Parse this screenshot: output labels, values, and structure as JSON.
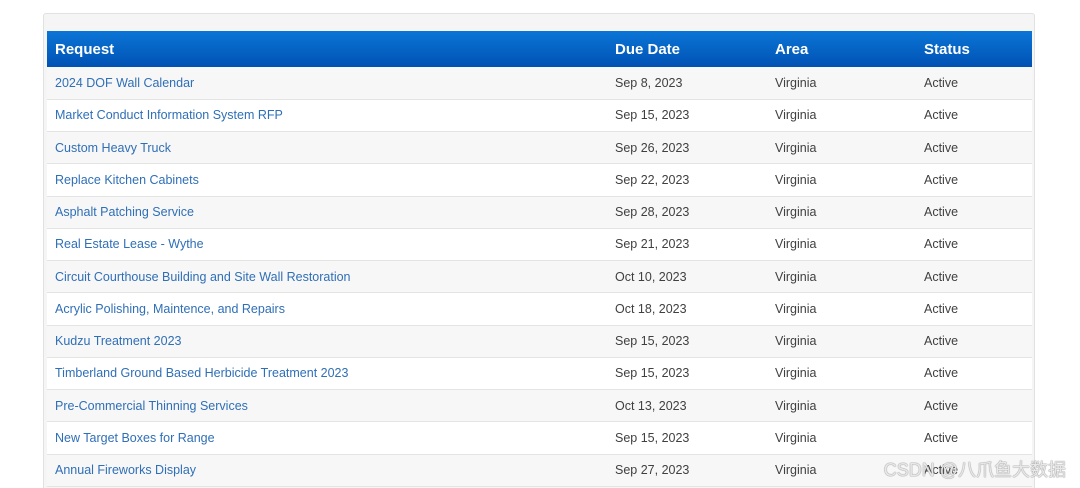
{
  "table": {
    "headers": {
      "request": "Request",
      "due_date": "Due Date",
      "area": "Area",
      "status": "Status"
    },
    "rows": [
      {
        "request": "2024 DOF Wall Calendar",
        "due_date": "Sep 8, 2023",
        "area": "Virginia",
        "status": "Active"
      },
      {
        "request": "Market Conduct Information System RFP",
        "due_date": "Sep 15, 2023",
        "area": "Virginia",
        "status": "Active"
      },
      {
        "request": "Custom Heavy Truck",
        "due_date": "Sep 26, 2023",
        "area": "Virginia",
        "status": "Active"
      },
      {
        "request": "Replace Kitchen Cabinets",
        "due_date": "Sep 22, 2023",
        "area": "Virginia",
        "status": "Active"
      },
      {
        "request": "Asphalt Patching Service",
        "due_date": "Sep 28, 2023",
        "area": "Virginia",
        "status": "Active"
      },
      {
        "request": "Real Estate Lease - Wythe",
        "due_date": "Sep 21, 2023",
        "area": "Virginia",
        "status": "Active"
      },
      {
        "request": "Circuit Courthouse Building and Site Wall Restoration",
        "due_date": "Oct 10, 2023",
        "area": "Virginia",
        "status": "Active"
      },
      {
        "request": "Acrylic Polishing, Maintence, and Repairs",
        "due_date": "Oct 18, 2023",
        "area": "Virginia",
        "status": "Active"
      },
      {
        "request": "Kudzu Treatment 2023",
        "due_date": "Sep 15, 2023",
        "area": "Virginia",
        "status": "Active"
      },
      {
        "request": "Timberland Ground Based Herbicide Treatment 2023",
        "due_date": "Sep 15, 2023",
        "area": "Virginia",
        "status": "Active"
      },
      {
        "request": "Pre-Commercial Thinning Services",
        "due_date": "Oct 13, 2023",
        "area": "Virginia",
        "status": "Active"
      },
      {
        "request": "New Target Boxes for Range",
        "due_date": "Sep 15, 2023",
        "area": "Virginia",
        "status": "Active"
      },
      {
        "request": "Annual Fireworks Display",
        "due_date": "Sep 27, 2023",
        "area": "Virginia",
        "status": "Active"
      }
    ]
  },
  "watermark": "CSDN @八爪鱼大数据",
  "colors": {
    "header_top": "#0b76d6",
    "header_bottom": "#0052b4",
    "link": "#2f6fb7",
    "text": "#404040"
  }
}
